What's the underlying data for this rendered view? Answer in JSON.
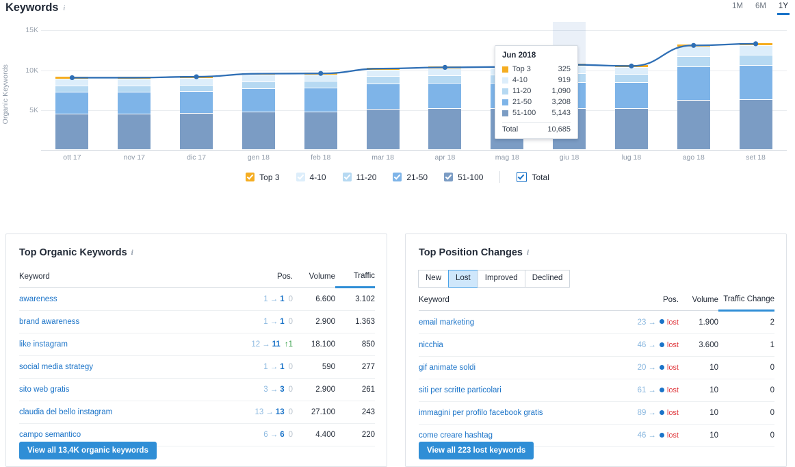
{
  "header": {
    "title": "Keywords",
    "info_icon": "info-icon",
    "ranges": [
      {
        "label": "1M",
        "active": false
      },
      {
        "label": "6M",
        "active": false
      },
      {
        "label": "1Y",
        "active": true
      }
    ]
  },
  "chart_data": {
    "type": "bar",
    "title": "Keywords",
    "xlabel": "",
    "ylabel": "Organic Keywords",
    "ylim": [
      0,
      16000
    ],
    "yticks": [
      "5K",
      "10K",
      "15K"
    ],
    "ytick_values": [
      5000,
      10000,
      15000
    ],
    "grid": true,
    "stacked": true,
    "legend_position": "bottom",
    "categories": [
      "ott 17",
      "nov 17",
      "dic 17",
      "gen 18",
      "feb 18",
      "mar 18",
      "apr 18",
      "mag 18",
      "giu 18",
      "lug 18",
      "ago 18",
      "set 18"
    ],
    "series": [
      {
        "name": "51-100",
        "color": "#7b9cc4",
        "values": [
          4450,
          4420,
          4470,
          4680,
          4690,
          5020,
          5080,
          5100,
          5143,
          5150,
          6120,
          6180
        ]
      },
      {
        "name": "21-50",
        "color": "#7eb4e8",
        "values": [
          2700,
          2690,
          2730,
          2920,
          2930,
          3120,
          3160,
          3180,
          3208,
          3190,
          4200,
          4260
        ]
      },
      {
        "name": "11-20",
        "color": "#b6d9f2",
        "values": [
          760,
          780,
          790,
          860,
          870,
          930,
          960,
          970,
          1090,
          1000,
          1280,
          1320
        ]
      },
      {
        "name": "4-10",
        "color": "#ddeefb",
        "values": [
          860,
          880,
          890,
          790,
          800,
          820,
          830,
          840,
          919,
          860,
          1150,
          1190
        ]
      },
      {
        "name": "Top 3",
        "color": "#f5ad21",
        "values": [
          300,
          300,
          305,
          310,
          310,
          315,
          318,
          320,
          325,
          320,
          330,
          335
        ]
      }
    ],
    "total_line": {
      "name": "Total",
      "color": "#2f6fb5",
      "values": [
        9070,
        9070,
        9185,
        9560,
        9600,
        10205,
        10348,
        10410,
        10685,
        10520,
        13080,
        13285
      ]
    },
    "tooltip": {
      "title": "Jun 2018",
      "rows": [
        {
          "label": "Top 3",
          "value": "325",
          "color": "#f5ad21"
        },
        {
          "label": "4-10",
          "value": "919",
          "color": "#ddeefb"
        },
        {
          "label": "11-20",
          "value": "1,090",
          "color": "#b6d9f2"
        },
        {
          "label": "21-50",
          "value": "3,208",
          "color": "#7eb4e8"
        },
        {
          "label": "51-100",
          "value": "5,143",
          "color": "#7b9cc4"
        }
      ],
      "total_label": "Total",
      "total_value": "10,685"
    },
    "legend": [
      {
        "label": "Top 3",
        "color": "#f5ad21",
        "checked": true
      },
      {
        "label": "4-10",
        "color": "#ddeefb",
        "checked": true
      },
      {
        "label": "11-20",
        "color": "#b6d9f2",
        "checked": true
      },
      {
        "label": "21-50",
        "color": "#7eb4e8",
        "checked": true
      },
      {
        "label": "51-100",
        "color": "#7b9cc4",
        "checked": true
      }
    ],
    "legend_total": {
      "label": "Total",
      "color": "#1a73c8",
      "checked": true
    }
  },
  "organic_panel": {
    "title": "Top Organic Keywords",
    "info_icon": "info-icon",
    "columns": [
      "Keyword",
      "Pos.",
      "Volume",
      "Traffic"
    ],
    "sorted_column": "Traffic",
    "rows": [
      {
        "keyword": "awareness",
        "pos_from": "1",
        "pos_to": "1",
        "delta": "0",
        "delta_dir": "none",
        "volume": "6.600",
        "traffic": "3.102"
      },
      {
        "keyword": "brand awareness",
        "pos_from": "1",
        "pos_to": "1",
        "delta": "0",
        "delta_dir": "none",
        "volume": "2.900",
        "traffic": "1.363"
      },
      {
        "keyword": "like instagram",
        "pos_from": "12",
        "pos_to": "11",
        "delta": "1",
        "delta_dir": "up",
        "volume": "18.100",
        "traffic": "850"
      },
      {
        "keyword": "social media strategy",
        "pos_from": "1",
        "pos_to": "1",
        "delta": "0",
        "delta_dir": "none",
        "volume": "590",
        "traffic": "277"
      },
      {
        "keyword": "sito web gratis",
        "pos_from": "3",
        "pos_to": "3",
        "delta": "0",
        "delta_dir": "none",
        "volume": "2.900",
        "traffic": "261"
      },
      {
        "keyword": "claudia del bello instagram",
        "pos_from": "13",
        "pos_to": "13",
        "delta": "0",
        "delta_dir": "none",
        "volume": "27.100",
        "traffic": "243"
      },
      {
        "keyword": "campo semantico",
        "pos_from": "6",
        "pos_to": "6",
        "delta": "0",
        "delta_dir": "none",
        "volume": "4.400",
        "traffic": "220"
      }
    ],
    "view_all_label": "View all 13,4K organic keywords"
  },
  "changes_panel": {
    "title": "Top Position Changes",
    "info_icon": "info-icon",
    "tabs": [
      {
        "label": "New",
        "active": false
      },
      {
        "label": "Lost",
        "active": true
      },
      {
        "label": "Improved",
        "active": false
      },
      {
        "label": "Declined",
        "active": false
      }
    ],
    "columns": [
      "Keyword",
      "Pos.",
      "Volume",
      "Traffic Change"
    ],
    "sorted_column": "Traffic Change",
    "lost_label": "lost",
    "rows": [
      {
        "keyword": "email marketing",
        "pos_from": "23",
        "status": "lost",
        "volume": "1.900",
        "traffic_change": "2",
        "muted": false
      },
      {
        "keyword": "nicchia",
        "pos_from": "46",
        "status": "lost",
        "volume": "3.600",
        "traffic_change": "1",
        "muted": true
      },
      {
        "keyword": "gif animate soldi",
        "pos_from": "20",
        "status": "lost",
        "volume": "10",
        "traffic_change": "0",
        "muted": false
      },
      {
        "keyword": "siti per scritte particolari",
        "pos_from": "61",
        "status": "lost",
        "volume": "10",
        "traffic_change": "0",
        "muted": false
      },
      {
        "keyword": "immagini per profilo facebook gratis",
        "pos_from": "89",
        "status": "lost",
        "volume": "10",
        "traffic_change": "0",
        "muted": false
      },
      {
        "keyword": "come creare hashtag",
        "pos_from": "46",
        "status": "lost",
        "volume": "10",
        "traffic_change": "0",
        "muted": false
      }
    ],
    "view_all_label": "View all 223 lost keywords"
  }
}
